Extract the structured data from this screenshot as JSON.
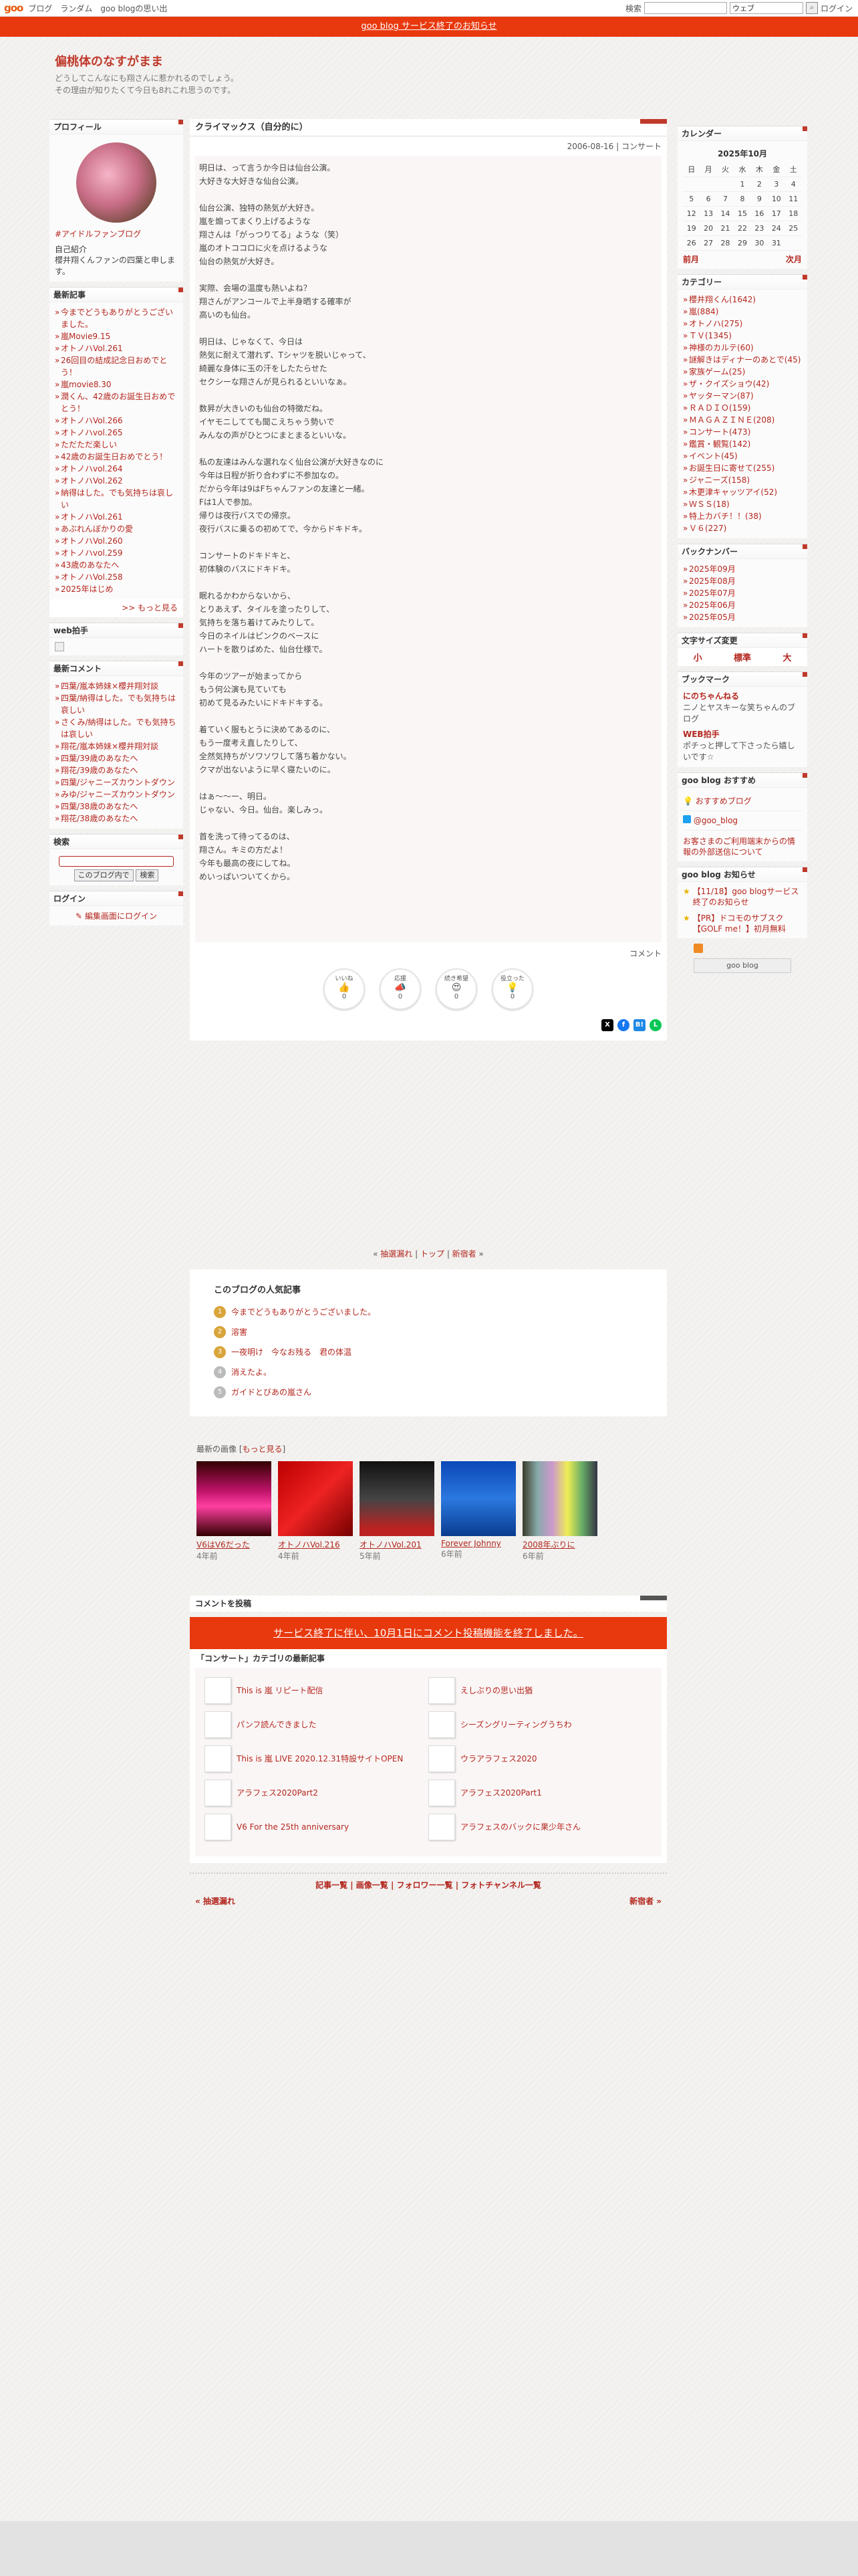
{
  "topbar": {
    "logo": "goo",
    "links": [
      "ブログ",
      "ランダム",
      "goo blogの思い出"
    ],
    "search_label": "検索",
    "search_select": "ウェブ",
    "login": "ログイン"
  },
  "notice": "goo blog サービス終了のお知らせ",
  "blog": {
    "title": "偏桃体のなすがまま",
    "desc1": "どうしてこんなにも翔さんに惹かれるのでしょう。",
    "desc2": "その理由が知りたくて今日も8れこれ思うのです。"
  },
  "profile": {
    "title": "プロフィール",
    "link": "#アイドルファンブログ",
    "intro_title": "自己紹介",
    "intro": "櫻井翔くんファンの四葉と申します。"
  },
  "recent": {
    "title": "最新記事",
    "items": [
      "今までどうもありがとうございました。",
      "嵐Movie9.15",
      "オトノハVol.261",
      "26回目の結成記念日おめでとう！",
      "嵐movie8.30",
      "潤くん、42歳のお誕生日おめでとう！",
      "オトノハVol.266",
      "オトノハvol.265",
      "ただただ楽しい",
      "42歳のお誕生日おめでとう！",
      "オトノハvol.264",
      "オトノハVol.262",
      "納得はした。でも気持ちは哀しい",
      "オトノハVol.261",
      "あぶれんぼかりの愛",
      "オトノハVol.260",
      "オトノハvol.259",
      "43歳のあなたへ",
      "オトノハVol.258",
      "2025年はじめ"
    ],
    "more": ">> もっと見る"
  },
  "webclap": {
    "title": "web拍手"
  },
  "comments": {
    "title": "最新コメント",
    "items": [
      "四葉/嵐本姉妹×櫻井翔対談",
      "四葉/納得はした。でも気持ちは哀しい",
      "さくみ/納得はした。でも気持ちは哀しい",
      "翔花/嵐本姉妹×櫻井翔対談",
      "四葉/39歳のあなたへ",
      "翔花/39歳のあなたへ",
      "四葉/ジャニーズカウントダウン",
      "みゆ/ジャニーズカウントダウン",
      "四葉/38歳のあなたへ",
      "翔花/38歳のあなたへ"
    ]
  },
  "search": {
    "title": "検索",
    "select": "このブログ内で",
    "button": "検索"
  },
  "login": {
    "title": "ログイン",
    "link": "編集画面にログイン"
  },
  "entry": {
    "title": "クライマックス（自分的に）",
    "date": "2006-08-16 | コンサート",
    "paras": [
      "明日は、って言うか今日は仙台公演。\n大好きな大好きな仙台公演。",
      "仙台公演、独特の熱気が大好き。\n嵐を煽ってまくり上げるような\n翔さんは「がっつりてる」ような（笑）\n嵐のオトココロに火を点けるような\n仙台の熱気が大好き。",
      "実際、会場の温度も熱いよね？\n翔さんがアンコールで上半身晒する確率が\n高いのも仙台。",
      "明日は、じゃなくて、今日は\n熱気に耐えて潜れず、Tシャツを脱いじゃって、\n綺麗な身体に玉の汗をしたたらせた\nセクシーな翔さんが見られるといいなぁ。",
      "数昇が大きいのも仙台の特徴だね。\nイヤモニしてても聞こえちゃう勢いで\nみんなの声がひとつにまとまるといいな。",
      "私の友達はみんな選れなく仙台公演が大好きなのに\n今年は日程が折り合わずに不参加なの。\nだから今年は9はFちゃんファンの友達と一緒。\nFは1人で参加。\n帰りは夜行バスでの帰京。\n夜行バスに乗るの初めてで、今からドキドキ。",
      "コンサートのドキドキと、\n初体験のバスにドキドキ。",
      "眠れるかわからないから、\nとりあえず、タイルを塗ったりして、\n気持ちを落ち着けてみたりして。\n今日のネイルはピンクのベースに\nハートを散りばめた、仙台仕様で。",
      "今年のツアーが始まってから\nもう何公演も見ていても\n初めて見るみたいにドキドキする。",
      "着ていく服もとうに決めてあるのに、\nもう一度考え直したりして、\n全然気持ちがソワソワして落ち着かない。\nクマが出ないように早く寝たいのに。",
      "はぁ～～ー、明日。\nじゃない、今日。仙台。楽しみっ。",
      "首を洗って待ってるのは、\n翔さん。キミの方だよ！\n今年も最高の夜にしてね。\nめいっぱいついてくから。"
    ],
    "footer": "コメント"
  },
  "reactions": [
    {
      "label": "いいね",
      "icon": "👍",
      "count": "0"
    },
    {
      "label": "応援",
      "icon": "📣",
      "count": "0"
    },
    {
      "label": "続き希望",
      "icon": "😍",
      "count": "0"
    },
    {
      "label": "役立った",
      "icon": "💡",
      "count": "0"
    }
  ],
  "share": [
    "X",
    "f",
    "B!",
    "L"
  ],
  "pager": {
    "prev": "抽選漏れ",
    "top": "トップ",
    "next": "新宿者"
  },
  "popular": {
    "title": "このブログの人気記事",
    "items": [
      {
        "rank": "1",
        "text": "今までどうもありがとうございました。"
      },
      {
        "rank": "2",
        "text": "溶害"
      },
      {
        "rank": "3",
        "text": "一夜明け　今なお残る　君の体温"
      },
      {
        "rank": "4",
        "text": "消えたよ。"
      },
      {
        "rank": "5",
        "text": "ガイドとびあの嵐さん"
      }
    ]
  },
  "images": {
    "title": "最新の画像",
    "more": "もっと見る",
    "items": [
      {
        "caption": "V6はV6だった",
        "age": "4年前"
      },
      {
        "caption": "オトノハVol.216",
        "age": "4年前"
      },
      {
        "caption": "オトノハVol.201",
        "age": "5年前"
      },
      {
        "caption": "Forever Johnny",
        "age": "6年前"
      },
      {
        "caption": "2008年ぶりに",
        "age": "6年前"
      }
    ]
  },
  "comment_form": {
    "title": "コメントを投稿",
    "notice": "サービス終了に伴い、10月1日にコメント投稿機能を終了しました。"
  },
  "category_recent": {
    "title": "「コンサート」カテゴリの最新記事",
    "items": [
      "This is 嵐 リピート配信",
      "えしぶりの思い出猶",
      "パンフ読んできました",
      "シーズングリーティングうちわ",
      "This is 嵐 LIVE 2020.12.31特設サイトOPEN",
      "ウラアラフェス2020",
      "アラフェス2020Part2",
      "アラフェス2020Part1",
      "V6 For the 25th anniversary",
      "アラフェスのバックに果少年さん"
    ]
  },
  "bottom_links": "記事一覧 | 画像一覧 | フォロワー一覧 | フォトチャンネル一覧",
  "bottom_nav": {
    "prev": "« 抽選漏れ",
    "next": "新宿者 »"
  },
  "calendar": {
    "title": "カレンダー",
    "month": "2025年10月",
    "days": [
      "日",
      "月",
      "火",
      "水",
      "木",
      "金",
      "土"
    ],
    "weeks": [
      [
        "",
        "",
        "",
        "1",
        "2",
        "3",
        "4"
      ],
      [
        "5",
        "6",
        "7",
        "8",
        "9",
        "10",
        "11"
      ],
      [
        "12",
        "13",
        "14",
        "15",
        "16",
        "17",
        "18"
      ],
      [
        "19",
        "20",
        "21",
        "22",
        "23",
        "24",
        "25"
      ],
      [
        "26",
        "27",
        "28",
        "29",
        "30",
        "31",
        ""
      ]
    ],
    "prev": "前月",
    "next": "次月"
  },
  "categories": {
    "title": "カテゴリー",
    "items": [
      "櫻井翔くん(1642)",
      "嵐(884)",
      "オトノハ(275)",
      "ＴＶ(1345)",
      "神様のカルテ(60)",
      "謎解きはディナーのあとで(45)",
      "家族ゲーム(25)",
      "ザ・クイズショウ(42)",
      "ヤッターマン(87)",
      "ＲＡＤＩＯ(159)",
      "ＭＡＧＡＺＩＮＥ(208)",
      "コンサート(473)",
      "鑑賞・観覧(142)",
      "イベント(45)",
      "お誕生日に寄せて(255)",
      "ジャニーズ(158)",
      "木更津キャッツアイ(52)",
      "ＷＳＳ(18)",
      "特上カバチ！！(38)",
      "Ｖ６(227)"
    ]
  },
  "backnumber": {
    "title": "バックナンバー",
    "items": [
      "2025年09月",
      "2025年08月",
      "2025年07月",
      "2025年06月",
      "2025年05月"
    ]
  },
  "fontsize": {
    "title": "文字サイズ変更",
    "small": "小",
    "normal": "標準",
    "large": "大"
  },
  "bookmarks": {
    "title": "ブックマーク",
    "items": [
      {
        "name": "にのちゃんねる",
        "desc": "ニノとヤスキーな笑ちゃんのブログ"
      },
      {
        "name": "WEB拍手",
        "desc": "ポチっと押して下さったら嬉しいです☆"
      }
    ]
  },
  "goo_recommend": {
    "title": "goo blog おすすめ",
    "items": [
      "おすすめブログ",
      "@goo_blog"
    ],
    "note": "お客さまのご利用端末からの情報の外部送信について"
  },
  "goo_news": {
    "title": "goo blog お知らせ",
    "items": [
      "【11/18】goo blogサービス終了のお知らせ",
      "【PR】ドコモのサブスク【GOLF me！】初月無料"
    ]
  },
  "gooblog_badge": "goo blog"
}
